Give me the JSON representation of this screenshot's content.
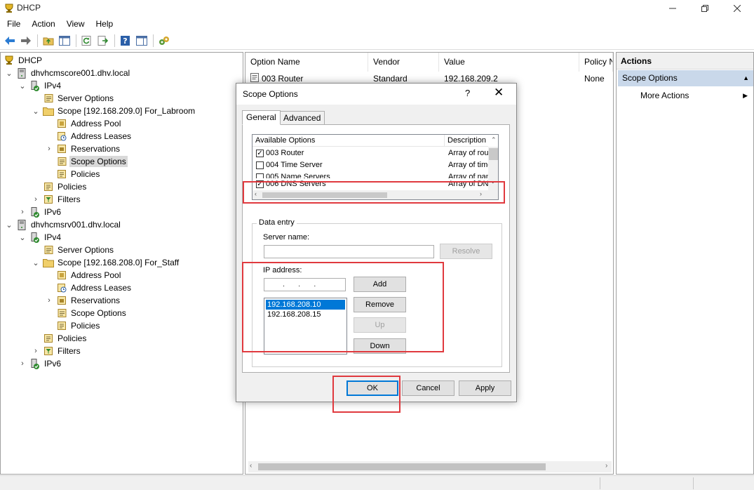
{
  "window": {
    "title": "DHCP",
    "minimize_icon": "minimize-icon",
    "maximize_icon": "restore-icon",
    "close_icon": "close-icon"
  },
  "menu": [
    "File",
    "Action",
    "View",
    "Help"
  ],
  "toolbar": [
    "back-arrow",
    "forward-arrow",
    "up-folder",
    "show-hide-console-tree",
    "refresh",
    "export-list",
    "help",
    "show-hide-action-pane",
    "dhcp-server"
  ],
  "tree": {
    "root": "DHCP",
    "server1": {
      "name": "dhvhcmscore001.dhv.local",
      "ipv4": "IPv4",
      "server_options": "Server Options",
      "scope": "Scope [192.168.209.0] For_Labroom",
      "address_pool": "Address Pool",
      "address_leases": "Address Leases",
      "reservations": "Reservations",
      "scope_options": "Scope Options",
      "scope_policies": "Policies",
      "policies": "Policies",
      "filters": "Filters",
      "ipv6": "IPv6"
    },
    "server2": {
      "name": "dhvhcmsrv001.dhv.local",
      "ipv4": "IPv4",
      "server_options": "Server Options",
      "scope": "Scope [192.168.208.0] For_Staff",
      "address_pool": "Address Pool",
      "address_leases": "Address Leases",
      "reservations": "Reservations",
      "scope_options": "Scope Options",
      "scope_policies": "Policies",
      "policies": "Policies",
      "filters": "Filters",
      "ipv6": "IPv6"
    }
  },
  "list": {
    "columns": [
      "Option Name",
      "Vendor",
      "Value",
      "Policy N"
    ],
    "rows": [
      {
        "name": "003 Router",
        "vendor": "Standard",
        "value": "192.168.209.2",
        "policy": "None"
      }
    ]
  },
  "actions": {
    "title": "Actions",
    "section": "Scope Options",
    "more": "More Actions"
  },
  "dialog": {
    "title": "Scope Options",
    "help": "?",
    "close": "✕",
    "tabs": [
      "General",
      "Advanced"
    ],
    "options_headers": [
      "Available Options",
      "Description"
    ],
    "options": [
      {
        "name": "003 Router",
        "desc": "Array of rout",
        "checked": true
      },
      {
        "name": "004 Time Server",
        "desc": "Array of time",
        "checked": false
      },
      {
        "name": "005 Name Servers",
        "desc": "Array of nam",
        "checked": false
      },
      {
        "name": "006 DNS Servers",
        "desc": "Array of DN",
        "checked": true
      }
    ],
    "data_entry": {
      "group_label": "Data entry",
      "server_name_label": "Server name:",
      "server_name_value": "",
      "resolve": "Resolve",
      "ip_label": "IP address:",
      "ip_value": ". . .",
      "add": "Add",
      "remove": "Remove",
      "up": "Up",
      "down": "Down",
      "ip_list": [
        "192.168.208.10",
        "192.168.208.15"
      ]
    },
    "buttons": {
      "ok": "OK",
      "cancel": "Cancel",
      "apply": "Apply"
    }
  },
  "highlight_color": "#e0393e",
  "selection_color": "#0078d7"
}
